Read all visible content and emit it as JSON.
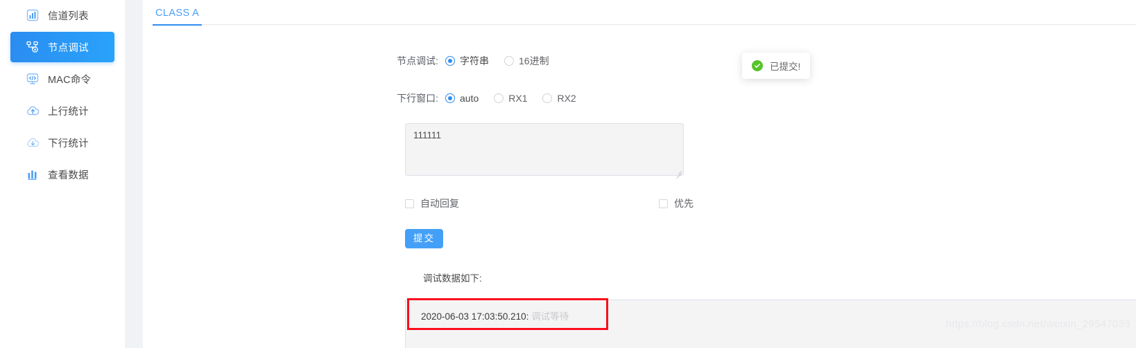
{
  "sidebar": {
    "items": [
      {
        "label": "信道列表",
        "icon": "chart-bars-icon",
        "active": false
      },
      {
        "label": "节点调试",
        "icon": "node-debug-icon",
        "active": true
      },
      {
        "label": "MAC命令",
        "icon": "code-monitor-icon",
        "active": false
      },
      {
        "label": "上行统计",
        "icon": "cloud-upload-icon",
        "active": false
      },
      {
        "label": "下行统计",
        "icon": "cloud-download-icon",
        "active": false
      },
      {
        "label": "查看数据",
        "icon": "bar-chart-icon",
        "active": false
      }
    ]
  },
  "tabs": [
    {
      "label": "CLASS A",
      "active": true
    }
  ],
  "form": {
    "mode_row": {
      "label": "节点调试:",
      "options": [
        {
          "label": "字符串",
          "checked": true
        },
        {
          "label": "16进制",
          "checked": false
        }
      ]
    },
    "window_row": {
      "label": "下行窗口:",
      "options": [
        {
          "label": "auto",
          "checked": true
        },
        {
          "label": "RX1",
          "checked": false
        },
        {
          "label": "RX2",
          "checked": false
        }
      ]
    },
    "payload": {
      "value": "111111",
      "placeholder": ""
    },
    "checkboxes": [
      {
        "label": "自动回复",
        "checked": false
      },
      {
        "label": "优先",
        "checked": false
      }
    ],
    "submit_label": "提交"
  },
  "debug": {
    "title": "调试数据如下:",
    "log_entries": [
      {
        "timestamp": "2020-06-03 17:03:50.210:",
        "message": "调试等待"
      }
    ]
  },
  "toast": {
    "text": "已提交!",
    "icon": "check-circle-icon",
    "color": "#56c42a"
  },
  "watermark": {
    "text": "https://blog.csdn.net/weixin_29547033"
  },
  "colors": {
    "accent": "#2f8cf0",
    "active_nav_start": "#2b8cf0",
    "active_nav_end": "#29a3fb",
    "highlight_box": "#fc0d1b",
    "panel_bg": "#f0f2f5"
  }
}
